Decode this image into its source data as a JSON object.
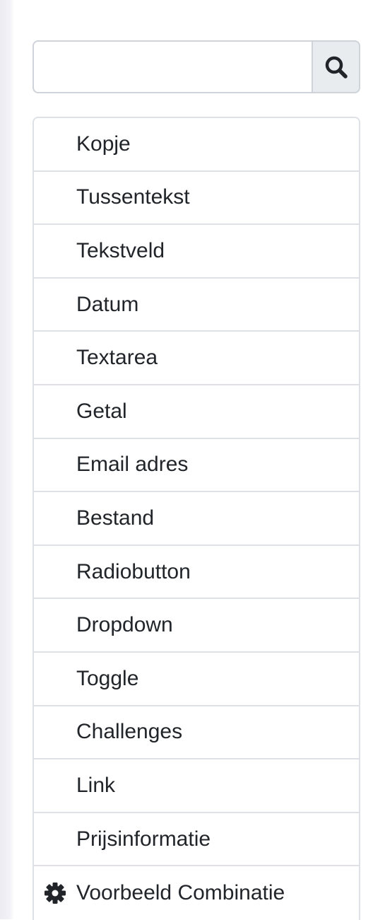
{
  "search": {
    "value": "",
    "placeholder": "",
    "button_icon": "search-icon"
  },
  "items": [
    {
      "label": "Kopje",
      "icon": ""
    },
    {
      "label": "Tussentekst",
      "icon": ""
    },
    {
      "label": "Tekstveld",
      "icon": ""
    },
    {
      "label": "Datum",
      "icon": ""
    },
    {
      "label": "Textarea",
      "icon": ""
    },
    {
      "label": "Getal",
      "icon": ""
    },
    {
      "label": "Email adres",
      "icon": ""
    },
    {
      "label": "Bestand",
      "icon": ""
    },
    {
      "label": "Radiobutton",
      "icon": ""
    },
    {
      "label": "Dropdown",
      "icon": ""
    },
    {
      "label": "Toggle",
      "icon": ""
    },
    {
      "label": "Challenges",
      "icon": ""
    },
    {
      "label": "Link",
      "icon": ""
    },
    {
      "label": "Prijsinformatie",
      "icon": ""
    },
    {
      "label": "Voorbeeld Combinatie",
      "icon": "gear-icon"
    }
  ],
  "colors": {
    "border": "#dee2e6",
    "button_bg": "#e9ecef",
    "text": "#212529",
    "icon": "#212529"
  }
}
